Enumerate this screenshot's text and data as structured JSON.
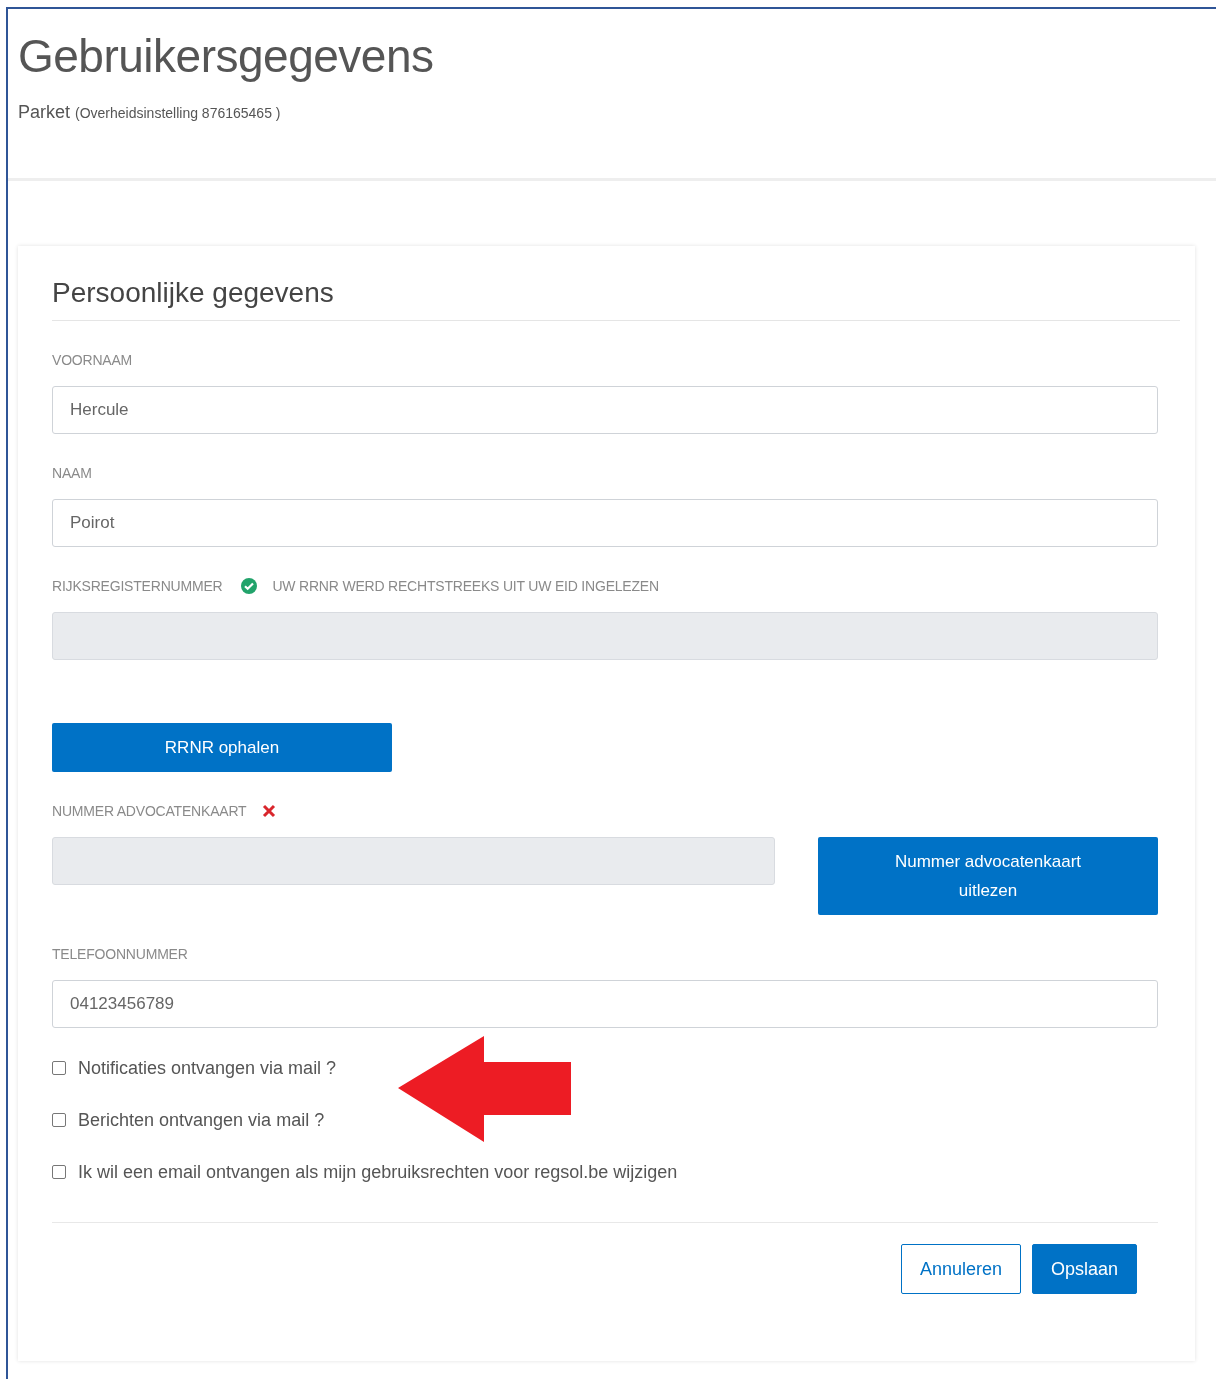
{
  "page": {
    "title": "Gebruikersgegevens",
    "organization": "Parket",
    "organization_detail": "(Overheidsinstelling 876165465 )"
  },
  "section": {
    "title": "Persoonlijke gegevens"
  },
  "fields": [
    {
      "kind": "plain",
      "label": "VOORNAAM",
      "value": "Hercule",
      "disabled": false
    },
    {
      "kind": "plain",
      "label": "NAAM",
      "value": "Poirot",
      "disabled": false
    },
    {
      "kind": "button-below",
      "label": "RIJKSREGISTERNUMMER",
      "validated": true,
      "note": "UW RRNR WERD RECHTSTREEKS UIT UW EID INGELEZEN",
      "disabled": true,
      "button": "RRNR ophalen"
    },
    {
      "kind": "button-beside",
      "label": "NUMMER ADVOCATENKAART",
      "validated": false,
      "disabled": true,
      "button": "Nummer advocatenkaart uitlezen"
    },
    {
      "kind": "plain",
      "label": "TELEFOONNUMMER",
      "value": "04123456789",
      "disabled": false
    }
  ],
  "checkboxes": [
    {
      "label": "Notificaties ontvangen via mail ?",
      "checked": false
    },
    {
      "label": "Berichten ontvangen via mail ?",
      "checked": false
    },
    {
      "label": "Ik wil een email ontvangen als mijn gebruiksrechten voor regsol.be wijzigen",
      "checked": false
    }
  ],
  "buttons": [
    {
      "label": "Annuleren",
      "kind": "secondary"
    },
    {
      "label": "Opslaan",
      "kind": "primary"
    }
  ]
}
